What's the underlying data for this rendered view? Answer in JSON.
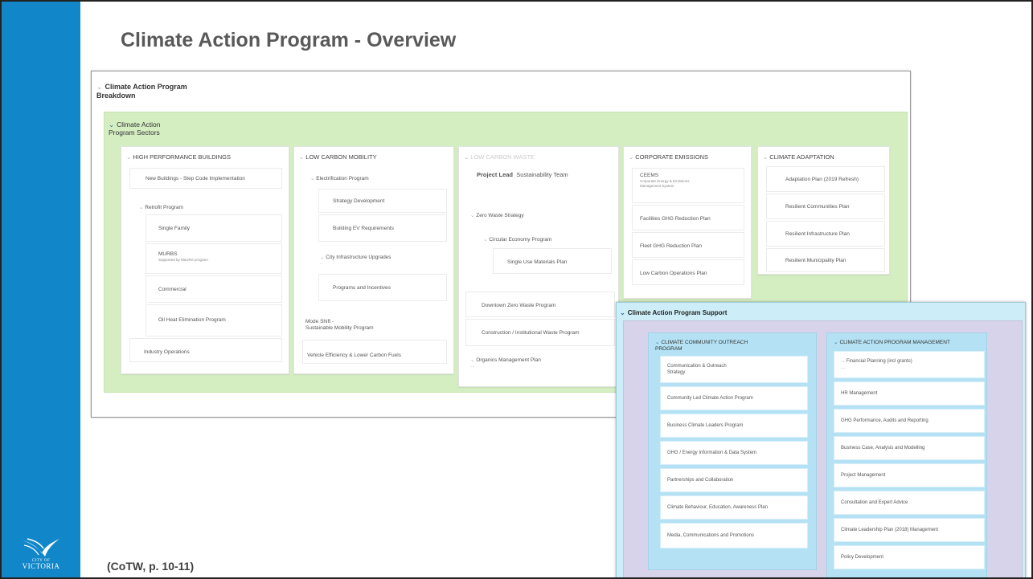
{
  "slide": {
    "title": "Climate Action Program - Overview",
    "citation": "(CoTW, p. 10-11)",
    "logo": {
      "line1": "CITY OF",
      "line2": "VICTORIA"
    }
  },
  "breakdown": {
    "header_line1": "Climate Action Program",
    "header_line2": "Breakdown",
    "sectors_line1": "Climate Action",
    "sectors_line2": "Program Sectors",
    "columns": {
      "hpb": {
        "title": "HIGH PERFORMANCE BUILDINGS",
        "items": [
          "New Buildings - Step Code Implementation",
          "Retrofit Program",
          "Single Family",
          "MURBS",
          "Supported by MaURS program",
          "Commercial",
          "Oil Heat Elimination Program",
          "Industry Operations"
        ]
      },
      "lcm": {
        "title": "LOW CARBON MOBILITY",
        "items": [
          "Electrification Program",
          "Strategy Development",
          "Building EV Requirements",
          "City Infrastructure Upgrades",
          "Programs and Incentives",
          "Mode Shift -",
          "Sustainable Mobility Program",
          "Vehicle Efficiency & Lower Carbon Fuels"
        ]
      },
      "lcw": {
        "title": "LOW CARBON WASTE",
        "project_lead": "Project Lead",
        "team": "Sustainability Team",
        "items": [
          "Zero Waste Strategy",
          "Circular Economy Program",
          "Single Use Materials Plan",
          "Downtown Zero Waste Program",
          "Construction / Institutional Waste Program",
          "Organics Management Plan"
        ]
      },
      "ce": {
        "title": "CORPORATE EMISSIONS",
        "items": [
          "CEEMS",
          "Corporate Energy & Emissions",
          "Management System",
          "Facilities GHG Reduction Plan",
          "Fleet GHG Reduction Plan",
          "Low Carbon Operations Plan"
        ]
      },
      "ca": {
        "title": "CLIMATE ADAPTATION",
        "items": [
          "Adaptation Plan (2019 Refresh)",
          "Resilient Communities Plan",
          "Resilient Infrastructure Plan",
          "Resilient Municipality Plan"
        ]
      }
    }
  },
  "support": {
    "header": "Climate Action Program Support",
    "outreach": {
      "title_line1": "CLIMATE COMMUNITY OUTREACH",
      "title_line2": "PROGRAM",
      "items": [
        "Communication & Outreach",
        "Strategy",
        "Community Led Climate Action Program",
        "Business Climate Leaders Program",
        "GHG / Energy Information & Data System",
        "Partnerships and Collaboration",
        "Climate Behaviour, Education, Awareness Plan",
        "Media, Communications and Promotions"
      ]
    },
    "management": {
      "title": "CLIMATE ACTION PROGRAM MANAGEMENT",
      "items": [
        "Financial Planning (incl grants)",
        "HR Management",
        "GHG Performance, Audits and Reporting",
        "Business Case, Analysis and Modelling",
        "Project Management",
        "Consultation and Expert Advice",
        "Climate Leadership Plan (2018) Management",
        "Policy Development"
      ]
    }
  }
}
